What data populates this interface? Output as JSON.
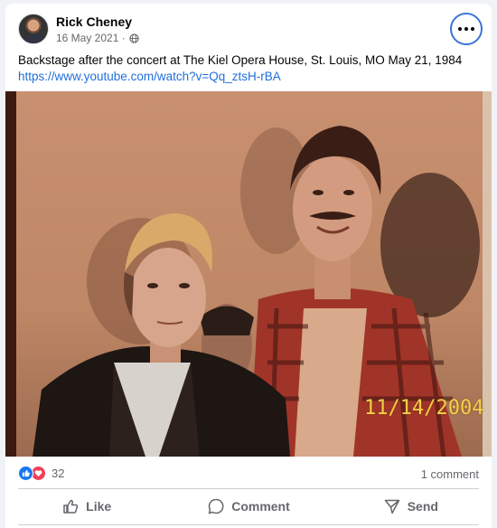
{
  "post": {
    "author": "Rick Cheney",
    "date": "16 May 2021 ·",
    "privacy_icon": "globe-icon",
    "caption": "Backstage after the concert at The Kiel Opera House, St. Louis, MO May 21, 1984",
    "link": "https://www.youtube.com/watch?v=Qq_ztsH-rBA",
    "more_icon": "more-options-icon"
  },
  "photo": {
    "date_stamp": "11/14/2004",
    "stamp_color": "#f2cf4a"
  },
  "stats": {
    "reactions": [
      "like-icon",
      "love-icon"
    ],
    "reaction_count": "32",
    "comment_count": "1 comment"
  },
  "actions": {
    "like_label": "Like",
    "comment_label": "Comment",
    "send_label": "Send"
  },
  "colors": {
    "accent": "#1877f2",
    "link": "#216fdb",
    "love": "#f33e58",
    "secondary_text": "#65676b"
  }
}
